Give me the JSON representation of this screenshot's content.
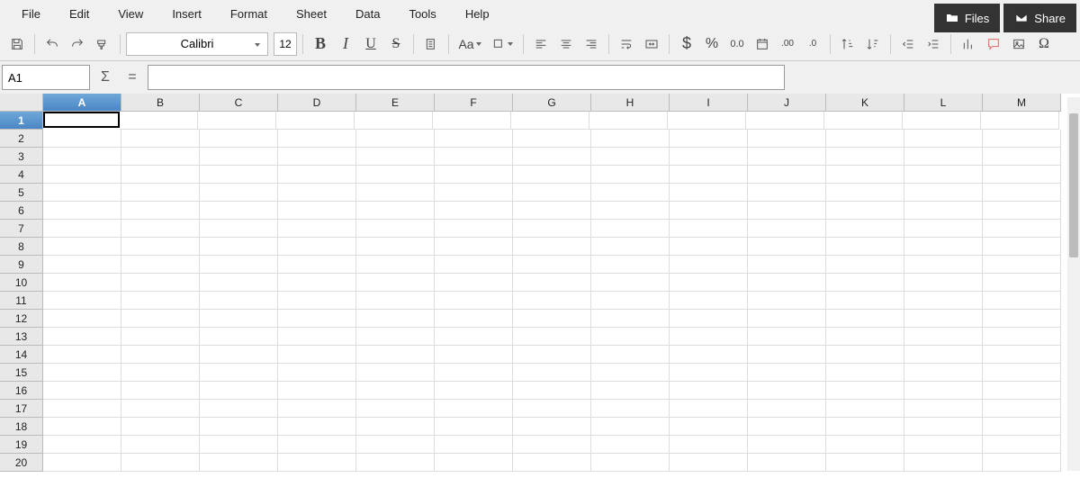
{
  "menubar": {
    "items": [
      "File",
      "Edit",
      "View",
      "Insert",
      "Format",
      "Sheet",
      "Data",
      "Tools",
      "Help"
    ]
  },
  "top_buttons": {
    "files_label": "Files",
    "share_label": "Share"
  },
  "toolbar": {
    "font_name": "Calibri",
    "font_size": "12",
    "bold": "B",
    "italic": "I",
    "underline": "U",
    "strike": "S",
    "case": "Aa",
    "currency": "$",
    "percent": "%",
    "number_fmt": "0.0",
    "add_decimal": ".00",
    "remove_decimal": ".0",
    "omega": "Ω"
  },
  "formula_bar": {
    "cell_ref": "A1",
    "sigma": "Σ",
    "equals": "=",
    "formula": ""
  },
  "grid": {
    "columns": [
      "A",
      "B",
      "C",
      "D",
      "E",
      "F",
      "G",
      "H",
      "I",
      "J",
      "K",
      "L",
      "M"
    ],
    "rows": [
      "1",
      "2",
      "3",
      "4",
      "5",
      "6",
      "7",
      "8",
      "9",
      "10",
      "11",
      "12",
      "13",
      "14",
      "15",
      "16",
      "17",
      "18",
      "19",
      "20"
    ],
    "active_col": "A",
    "active_row": "1",
    "selected_cell": "A1"
  }
}
